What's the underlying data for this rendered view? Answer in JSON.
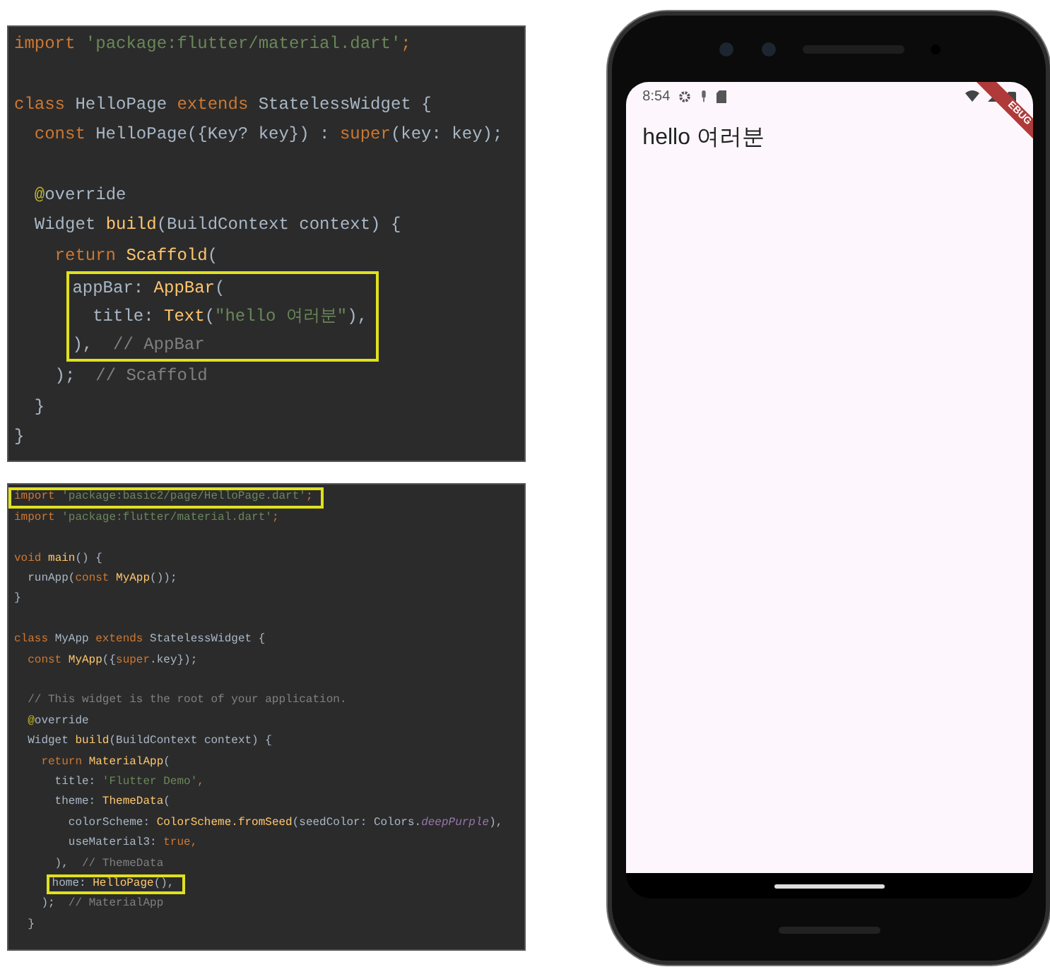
{
  "editors": [
    {
      "kind": "large",
      "lines": [
        {
          "kind": "code",
          "highlighted": false,
          "segments": [
            {
              "text": "import",
              "kind": "keyword"
            },
            {
              "text": " 'package:flutter/material.dart'",
              "kind": "string"
            },
            {
              "text": ";",
              "kind": "keyword"
            }
          ]
        },
        {
          "kind": "blank"
        },
        {
          "kind": "code",
          "highlighted": false,
          "segments": [
            {
              "text": "class ",
              "kind": "keyword"
            },
            {
              "text": "HelloPage ",
              "kind": "plain"
            },
            {
              "text": "extends ",
              "kind": "keyword"
            },
            {
              "text": "StatelessWidget {",
              "kind": "plain"
            }
          ]
        },
        {
          "kind": "code",
          "highlighted": false,
          "segments": [
            {
              "text": "  const ",
              "kind": "keyword"
            },
            {
              "text": "HelloPage({Key? key}) : ",
              "kind": "plain"
            },
            {
              "text": "super",
              "kind": "keyword"
            },
            {
              "text": "(key: key);",
              "kind": "plain"
            }
          ]
        },
        {
          "kind": "blank"
        },
        {
          "kind": "code",
          "highlighted": false,
          "segments": [
            {
              "text": "  @",
              "kind": "annotation"
            },
            {
              "text": "override",
              "kind": "plain"
            }
          ]
        },
        {
          "kind": "code",
          "highlighted": false,
          "segments": [
            {
              "text": "  Widget ",
              "kind": "plain"
            },
            {
              "text": "build",
              "kind": "call"
            },
            {
              "text": "(BuildContext context) {",
              "kind": "plain"
            }
          ]
        },
        {
          "kind": "code",
          "highlighted": false,
          "segments": [
            {
              "text": "    return ",
              "kind": "keyword"
            },
            {
              "text": "Scaffold",
              "kind": "call"
            },
            {
              "text": "(",
              "kind": "plain"
            }
          ]
        },
        {
          "kind": "code",
          "highlighted": true,
          "segments": [
            {
              "text": "      appBar: ",
              "kind": "plain"
            },
            {
              "text": "AppBar",
              "kind": "call"
            },
            {
              "text": "(",
              "kind": "plain"
            }
          ]
        },
        {
          "kind": "code",
          "highlighted": true,
          "segments": [
            {
              "text": "        title: ",
              "kind": "plain"
            },
            {
              "text": "Text",
              "kind": "call"
            },
            {
              "text": "(",
              "kind": "plain"
            },
            {
              "text": "\"hello 여러분\"",
              "kind": "string"
            },
            {
              "text": "),",
              "kind": "plain"
            }
          ]
        },
        {
          "kind": "code",
          "highlighted": true,
          "segments": [
            {
              "text": "      ),",
              "kind": "plain"
            },
            {
              "text": "  // AppBar",
              "kind": "comment"
            }
          ]
        },
        {
          "kind": "code",
          "highlighted": false,
          "segments": [
            {
              "text": "    );",
              "kind": "plain"
            },
            {
              "text": "  // Scaffold",
              "kind": "comment"
            }
          ]
        },
        {
          "kind": "code",
          "highlighted": false,
          "segments": [
            {
              "text": "  }",
              "kind": "plain"
            }
          ]
        },
        {
          "kind": "code",
          "highlighted": false,
          "segments": [
            {
              "text": "}",
              "kind": "plain"
            }
          ]
        }
      ]
    },
    {
      "kind": "small",
      "lines": [
        {
          "kind": "code",
          "highlighted": true,
          "segments": [
            {
              "text": "import",
              "kind": "keyword"
            },
            {
              "text": " 'package:basic2/page/HelloPage.dart'",
              "kind": "string"
            },
            {
              "text": ";",
              "kind": "keyword"
            }
          ]
        },
        {
          "kind": "code",
          "highlighted": false,
          "segments": [
            {
              "text": "import",
              "kind": "keyword"
            },
            {
              "text": " 'package:flutter/material.dart'",
              "kind": "string"
            },
            {
              "text": ";",
              "kind": "keyword"
            }
          ]
        },
        {
          "kind": "blank"
        },
        {
          "kind": "code",
          "highlighted": false,
          "segments": [
            {
              "text": "void ",
              "kind": "keyword"
            },
            {
              "text": "main",
              "kind": "call"
            },
            {
              "text": "() {",
              "kind": "plain"
            }
          ]
        },
        {
          "kind": "code",
          "highlighted": false,
          "segments": [
            {
              "text": "  runApp(",
              "kind": "plain"
            },
            {
              "text": "const ",
              "kind": "keyword"
            },
            {
              "text": "MyApp",
              "kind": "call"
            },
            {
              "text": "());",
              "kind": "plain"
            }
          ]
        },
        {
          "kind": "code",
          "highlighted": false,
          "segments": [
            {
              "text": "}",
              "kind": "plain"
            }
          ]
        },
        {
          "kind": "blank"
        },
        {
          "kind": "code",
          "highlighted": false,
          "segments": [
            {
              "text": "class ",
              "kind": "keyword"
            },
            {
              "text": "MyApp ",
              "kind": "plain"
            },
            {
              "text": "extends ",
              "kind": "keyword"
            },
            {
              "text": "StatelessWidget {",
              "kind": "plain"
            }
          ]
        },
        {
          "kind": "code",
          "highlighted": false,
          "segments": [
            {
              "text": "  const ",
              "kind": "keyword"
            },
            {
              "text": "MyApp",
              "kind": "call"
            },
            {
              "text": "({",
              "kind": "plain"
            },
            {
              "text": "super",
              "kind": "keyword"
            },
            {
              "text": ".key});",
              "kind": "plain"
            }
          ]
        },
        {
          "kind": "blank"
        },
        {
          "kind": "code",
          "highlighted": false,
          "segments": [
            {
              "text": "  // This widget is the root of your application.",
              "kind": "comment"
            }
          ]
        },
        {
          "kind": "code",
          "highlighted": false,
          "segments": [
            {
              "text": "  @",
              "kind": "annotation"
            },
            {
              "text": "override",
              "kind": "plain"
            }
          ]
        },
        {
          "kind": "code",
          "highlighted": false,
          "segments": [
            {
              "text": "  Widget ",
              "kind": "plain"
            },
            {
              "text": "build",
              "kind": "call"
            },
            {
              "text": "(BuildContext context) {",
              "kind": "plain"
            }
          ]
        },
        {
          "kind": "code",
          "highlighted": false,
          "segments": [
            {
              "text": "    return ",
              "kind": "keyword"
            },
            {
              "text": "MaterialApp",
              "kind": "call"
            },
            {
              "text": "(",
              "kind": "plain"
            }
          ]
        },
        {
          "kind": "code",
          "highlighted": false,
          "segments": [
            {
              "text": "      title: ",
              "kind": "plain"
            },
            {
              "text": "'Flutter Demo'",
              "kind": "string"
            },
            {
              "text": ",",
              "kind": "keyword"
            }
          ]
        },
        {
          "kind": "code",
          "highlighted": false,
          "segments": [
            {
              "text": "      theme: ",
              "kind": "plain"
            },
            {
              "text": "ThemeData",
              "kind": "call"
            },
            {
              "text": "(",
              "kind": "plain"
            }
          ]
        },
        {
          "kind": "code",
          "highlighted": false,
          "segments": [
            {
              "text": "        colorScheme: ",
              "kind": "plain"
            },
            {
              "text": "ColorScheme.fromSeed",
              "kind": "call"
            },
            {
              "text": "(seedColor: Colors.",
              "kind": "plain"
            },
            {
              "text": "deepPurple",
              "kind": "field"
            },
            {
              "text": "),",
              "kind": "plain"
            }
          ]
        },
        {
          "kind": "code",
          "highlighted": false,
          "segments": [
            {
              "text": "        useMaterial3: ",
              "kind": "plain"
            },
            {
              "text": "true",
              "kind": "keyword"
            },
            {
              "text": ",",
              "kind": "keyword"
            }
          ]
        },
        {
          "kind": "code",
          "highlighted": false,
          "segments": [
            {
              "text": "      ),",
              "kind": "plain"
            },
            {
              "text": "  // ThemeData",
              "kind": "comment"
            }
          ]
        },
        {
          "kind": "code",
          "highlighted": true,
          "segments": [
            {
              "text": "      home: ",
              "kind": "plain"
            },
            {
              "text": "HelloPage",
              "kind": "call"
            },
            {
              "text": "(),",
              "kind": "plain"
            }
          ]
        },
        {
          "kind": "code",
          "highlighted": false,
          "segments": [
            {
              "text": "    );",
              "kind": "plain"
            },
            {
              "text": "  // MaterialApp",
              "kind": "comment"
            }
          ]
        },
        {
          "kind": "code",
          "highlighted": false,
          "segments": [
            {
              "text": "  }",
              "kind": "plain"
            }
          ]
        }
      ]
    }
  ],
  "phone": {
    "status_bar": {
      "time": "8:54"
    },
    "debug_banner": "EBUG",
    "body_text": "hello 여러분"
  }
}
